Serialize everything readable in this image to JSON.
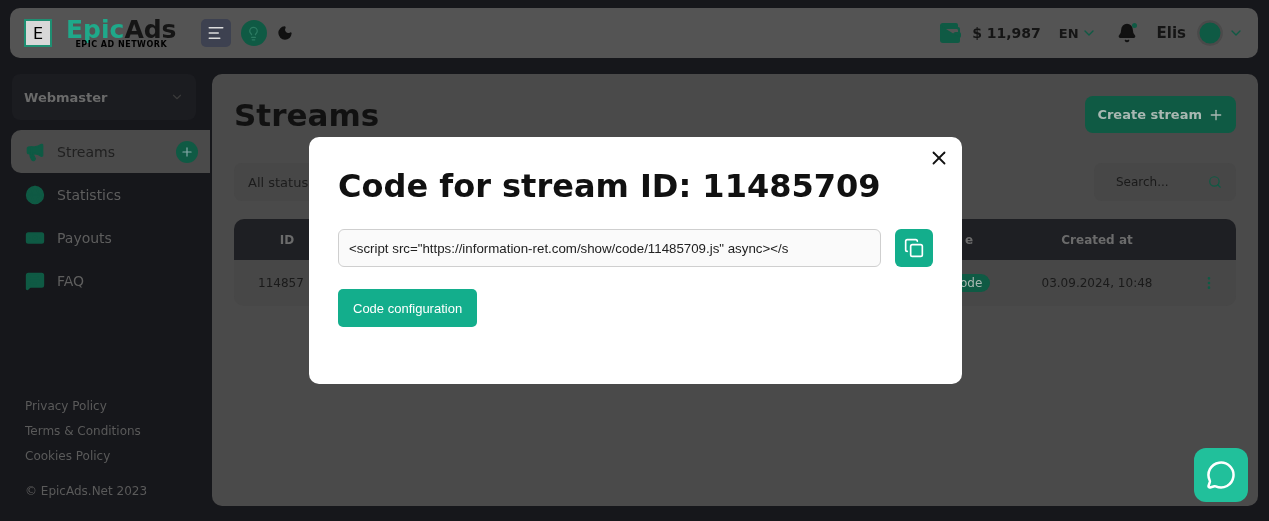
{
  "header": {
    "logo": {
      "mark": "E",
      "first": "Epic",
      "second": "Ads",
      "tagline": "EPIC AD NETWORK"
    },
    "balance": "$ 11,987",
    "language": "EN",
    "notifications": true,
    "user": "Elis"
  },
  "sidebar": {
    "role": "Webmaster",
    "items": [
      {
        "label": "Streams",
        "selected": true,
        "add": true
      },
      {
        "label": "Statistics",
        "selected": false,
        "add": false
      },
      {
        "label": "Payouts",
        "selected": false,
        "add": false
      },
      {
        "label": "FAQ",
        "selected": false,
        "add": false
      }
    ],
    "footer": [
      "Privacy Policy",
      "Terms & Conditions",
      "Cookies Policy"
    ],
    "copyright": "© EpicAds.Net 2023"
  },
  "page": {
    "title": "Streams",
    "create_button": "Create stream",
    "filter": "All status",
    "search": {
      "placeholder": "Search..."
    },
    "table": {
      "columns": [
        "ID",
        "e",
        "Created at"
      ],
      "rows": [
        {
          "id": "114857",
          "badge": "ode",
          "created": "03.09.2024, 10:48"
        }
      ]
    }
  },
  "modal": {
    "title": "Code for stream ID: 11485709",
    "code": "<script src=\"https://information-ret.com/show/code/11485709.js\" async></s",
    "button": "Code configuration"
  }
}
